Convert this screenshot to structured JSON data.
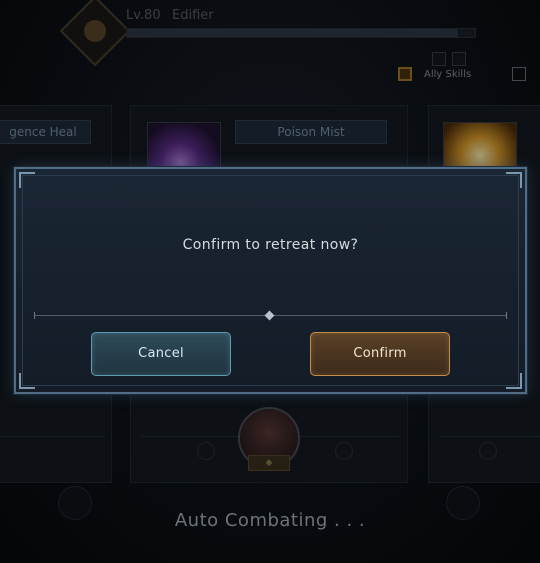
{
  "hero": {
    "level": "Lv.80",
    "name": "Edifier",
    "hp_fraction": 0.95
  },
  "toggles": {
    "ally_skills_label": "Ally Skills",
    "ally_skills_checked": true
  },
  "skill_cards": [
    {
      "title": "gence Heal"
    },
    {
      "title": "Poison Mist"
    },
    {
      "title": ""
    }
  ],
  "status": {
    "auto_combat_text": "Auto Combating . . ."
  },
  "dialog": {
    "message": "Confirm to retreat now?",
    "cancel_label": "Cancel",
    "confirm_label": "Confirm"
  },
  "colors": {
    "cancel_accent": "#5d9cb4",
    "confirm_accent": "#c48d4a",
    "dialog_border": "#4f6d86"
  }
}
